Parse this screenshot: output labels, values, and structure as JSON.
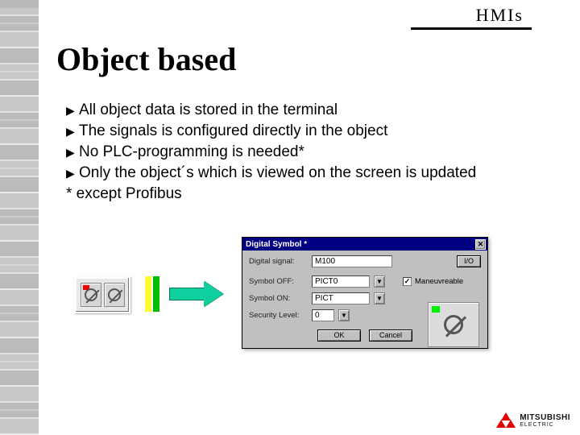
{
  "header": {
    "label": "HMIs"
  },
  "title": "Object based",
  "bullets": [
    "All object data is stored in the terminal",
    "The signals is configured directly in the object",
    "No PLC-programming is needed*",
    "Only the object´s which is viewed on the screen is updated"
  ],
  "footnote": "* except Profibus",
  "dialog": {
    "title": "Digital Symbol *",
    "labels": {
      "signal": "Digital signal:",
      "off": "Symbol OFF:",
      "on": "Symbol ON:",
      "security": "Security Level:"
    },
    "values": {
      "signal": "M100",
      "off": "PICT0",
      "on": "PICT",
      "security": "0"
    },
    "io_btn": "I/O",
    "checkbox": {
      "checked": true,
      "label": "Maneuvreable"
    },
    "buttons": {
      "ok": "OK",
      "cancel": "Cancel"
    }
  },
  "logo": {
    "line1": "MITSUBISHI",
    "line2": "ELECTRIC"
  }
}
